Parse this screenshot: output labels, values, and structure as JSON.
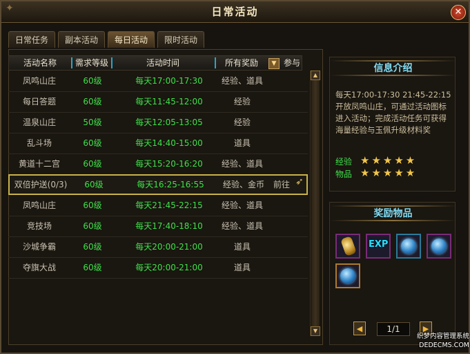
{
  "window": {
    "title": "日常活动",
    "close_label": "✕"
  },
  "tabs": [
    {
      "label": "日常任务",
      "active": false
    },
    {
      "label": "副本活动",
      "active": false
    },
    {
      "label": "每日活动",
      "active": true
    },
    {
      "label": "限时活动",
      "active": false
    }
  ],
  "table": {
    "headers": {
      "name": "活动名称",
      "level": "需求等级",
      "time": "活动时间",
      "reward": "所有奖励",
      "join": "参与"
    },
    "rows": [
      {
        "name": "凤鸣山庄",
        "level": "60级",
        "time": "每天17:00-17:30",
        "reward": "经验、道具",
        "join": ""
      },
      {
        "name": "每日答题",
        "level": "60级",
        "time": "每天11:45-12:00",
        "reward": "经验",
        "join": ""
      },
      {
        "name": "温泉山庄",
        "level": "50级",
        "time": "每天12:05-13:05",
        "reward": "经验",
        "join": ""
      },
      {
        "name": "乱斗场",
        "level": "60级",
        "time": "每天14:40-15:00",
        "reward": "道具",
        "join": ""
      },
      {
        "name": "黄道十二宫",
        "level": "60级",
        "time": "每天15:20-16:20",
        "reward": "经验、道具",
        "join": ""
      },
      {
        "name": "双倍护送(0/3)",
        "level": "60级",
        "time": "每天16:25-16:55",
        "reward": "经验、金币",
        "join": "前往",
        "selected": true
      },
      {
        "name": "凤鸣山庄",
        "level": "60级",
        "time": "每天21:45-22:15",
        "reward": "经验、道具",
        "join": ""
      },
      {
        "name": "竞技场",
        "level": "60级",
        "time": "每天17:40-18:10",
        "reward": "经验、道具",
        "join": ""
      },
      {
        "name": "沙城争霸",
        "level": "60级",
        "time": "每天20:00-21:00",
        "reward": "道具",
        "join": ""
      },
      {
        "name": "夺旗大战",
        "level": "60级",
        "time": "每天20:00-21:00",
        "reward": "道具",
        "join": ""
      }
    ]
  },
  "info": {
    "title": "信息介绍",
    "description": "每天17:00-17:30 21:45-22:15开放凤鸣山庄，可通过活动图标进入活动；完成活动任务可获得海量经验与玉佩升级材料奖",
    "ratings": [
      {
        "label": "经验",
        "stars": 5
      },
      {
        "label": "物品",
        "stars": 5
      }
    ]
  },
  "rewards": {
    "title": "奖励物品",
    "items": [
      {
        "icon": "gold-medal-icon"
      },
      {
        "icon": "exp-icon",
        "text": "EXP"
      },
      {
        "icon": "blue-orb-icon"
      },
      {
        "icon": "blue-orb-icon"
      },
      {
        "icon": "blue-orb-icon"
      }
    ],
    "page": "1/1"
  },
  "watermark": {
    "line1": "织梦内容管理系统",
    "line2": "DEDECMS.COM"
  },
  "colors": {
    "accent_green": "#3fe04a",
    "title_cyan": "#7fd8ef",
    "gold": "#f1c64a"
  }
}
